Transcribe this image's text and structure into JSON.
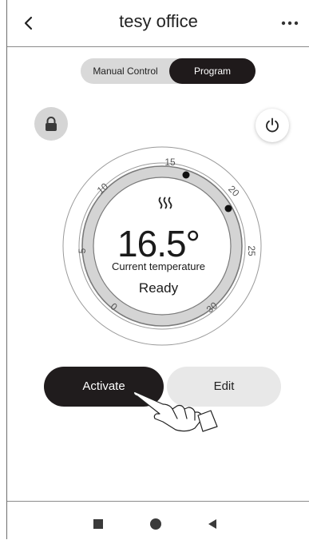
{
  "header": {
    "title": "tesy office",
    "back_icon": "chevron-left-icon",
    "more_icon": "more-dots-icon"
  },
  "mode_toggle": {
    "manual_label": "Manual Control",
    "program_label": "Program",
    "selected": "Program"
  },
  "controls": {
    "lock_icon": "lock-icon",
    "power_icon": "power-icon"
  },
  "dial": {
    "scale_labels": [
      "0",
      "5",
      "10",
      "15",
      "20",
      "25",
      "30"
    ],
    "current_temperature": "16.5°",
    "current_temperature_label": "Current temperature",
    "status": "Ready",
    "heating_icon": "heat-waves-icon"
  },
  "actions": {
    "activate_label": "Activate",
    "edit_label": "Edit"
  },
  "navbar": {
    "icons": [
      "stop-square-icon",
      "home-circle-icon",
      "back-triangle-icon"
    ]
  },
  "colors": {
    "dark": "#1f1a1b",
    "ring": "#d4d4d4",
    "secondary": "#e8e8e8"
  }
}
